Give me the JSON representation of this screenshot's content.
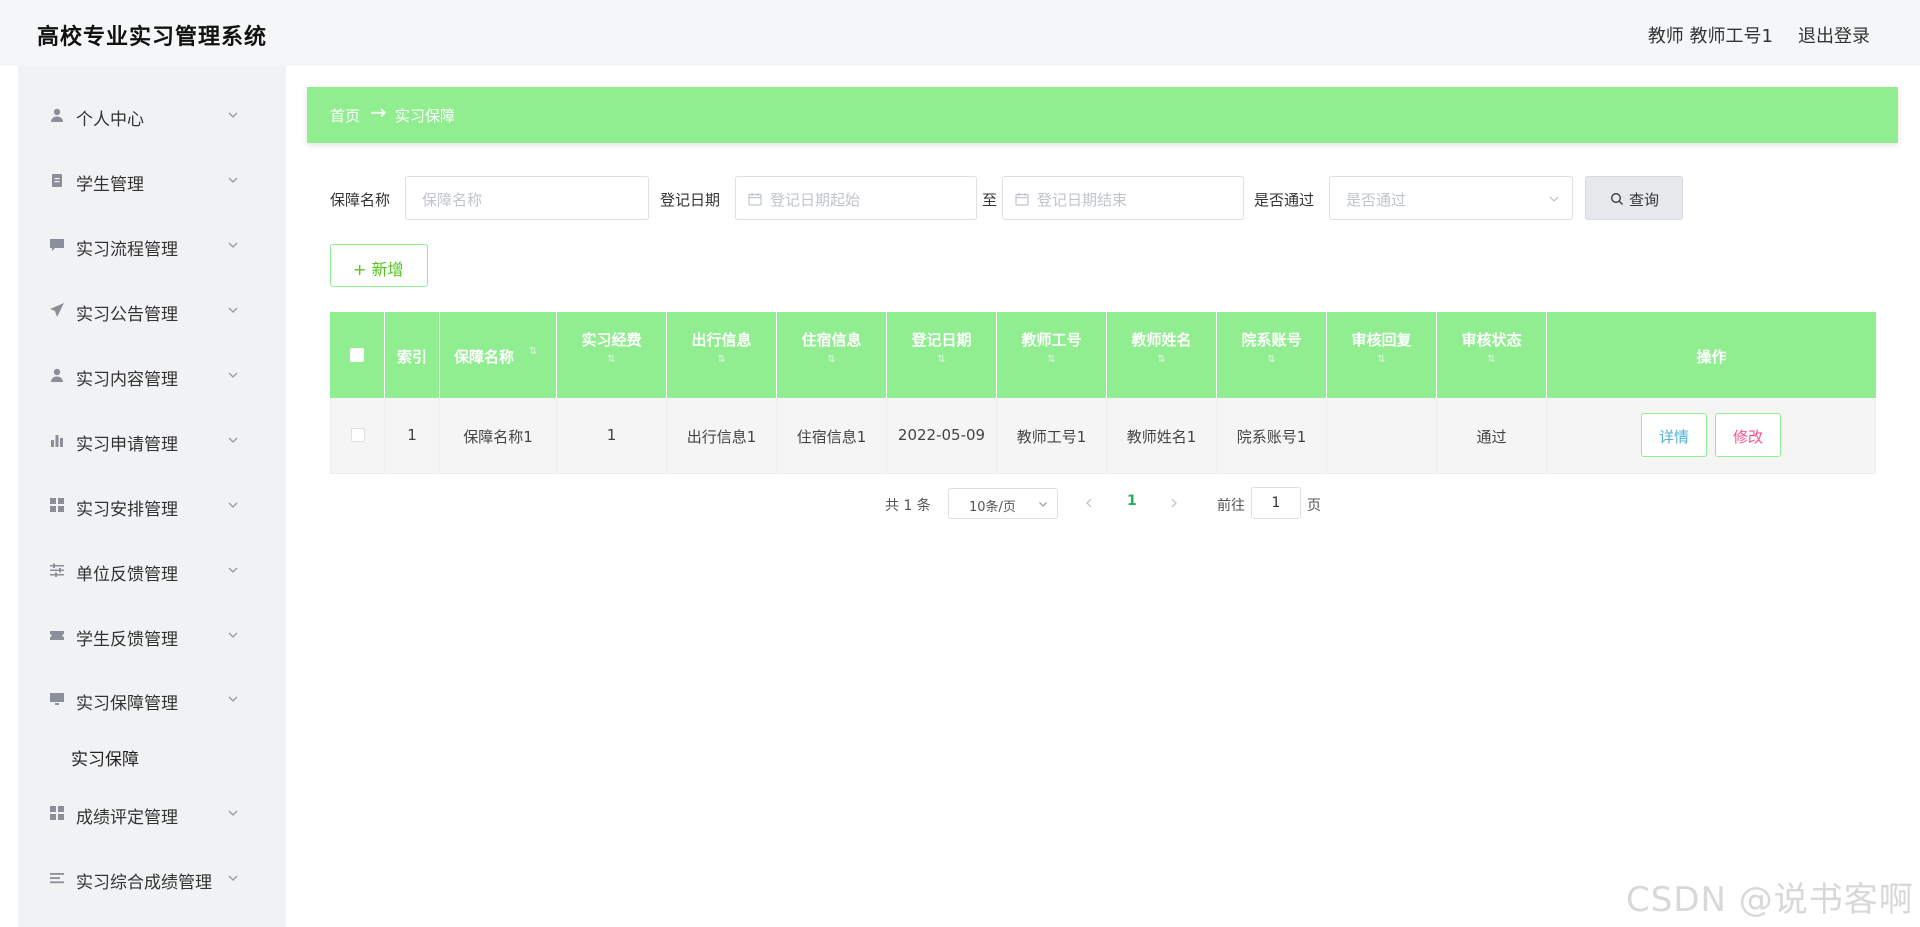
{
  "header": {
    "title": "高校专业实习管理系统",
    "user": "教师 教师工号1",
    "logout": "退出登录"
  },
  "sidebar": {
    "items": [
      {
        "label": "个人中心",
        "icon": "user-icon"
      },
      {
        "label": "学生管理",
        "icon": "clipboard-icon"
      },
      {
        "label": "实习流程管理",
        "icon": "chat-icon"
      },
      {
        "label": "实习公告管理",
        "icon": "paper-plane-icon"
      },
      {
        "label": "实习内容管理",
        "icon": "user-icon"
      },
      {
        "label": "实习申请管理",
        "icon": "bar-chart-icon"
      },
      {
        "label": "实习安排管理",
        "icon": "grid-icon"
      },
      {
        "label": "单位反馈管理",
        "icon": "sliders-icon"
      },
      {
        "label": "学生反馈管理",
        "icon": "ticket-icon"
      },
      {
        "label": "实习保障管理",
        "icon": "monitor-icon"
      },
      {
        "label": "成绩评定管理",
        "icon": "grid-icon"
      },
      {
        "label": "实习综合成绩管理",
        "icon": "menu-lines-icon"
      }
    ],
    "submenu": {
      "label": "实习保障"
    }
  },
  "breadcrumb": {
    "home": "首页",
    "separator": "→",
    "current": "实习保障"
  },
  "filters": {
    "name_label": "保障名称",
    "name_placeholder": "保障名称",
    "date_label": "登记日期",
    "date_start_placeholder": "登记日期起始",
    "date_to": "至",
    "date_end_placeholder": "登记日期结束",
    "pass_label": "是否通过",
    "pass_placeholder": "是否通过",
    "query_button": "查询"
  },
  "add_button": "+ 新增",
  "table": {
    "headers": [
      "索引",
      "保障名称",
      "实习经费",
      "出行信息",
      "住宿信息",
      "登记日期",
      "教师工号",
      "教师姓名",
      "院系账号",
      "审核回复",
      "审核状态",
      "操作"
    ],
    "rows": [
      [
        "1",
        "保障名称1",
        "1",
        "出行信息1",
        "住宿信息1",
        "2022-05-09",
        "教师工号1",
        "教师姓名1",
        "院系账号1",
        "",
        "通过"
      ]
    ],
    "detail_button": "详情",
    "edit_button": "修改"
  },
  "pagination": {
    "total": "共 1 条",
    "page_size": "10条/页",
    "current": "1",
    "goto": "前往",
    "goto_value": "1",
    "page_unit": "页"
  },
  "watermark": "CSDN @说书客啊",
  "colors": {
    "accent": "#90ee90",
    "detail": "#4fb0d8",
    "edit": "#ff4d8a"
  }
}
